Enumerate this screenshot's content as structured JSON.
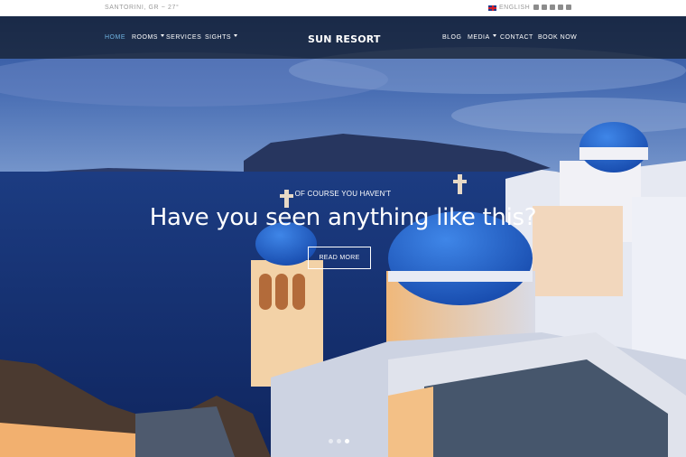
{
  "topbar": {
    "location": "SANTORINI, GR ~ 27°",
    "language": "ENGLISH",
    "socials": [
      "facebook-icon",
      "twitter-icon",
      "youtube-icon",
      "instagram-icon",
      "linkedin-icon"
    ]
  },
  "nav": {
    "brand": "SUN RESORT",
    "left": [
      {
        "label": "HOME",
        "active": true,
        "dropdown": false
      },
      {
        "label": "ROOMS",
        "active": false,
        "dropdown": true
      },
      {
        "label": "SERVICES",
        "active": false,
        "dropdown": false
      },
      {
        "label": "SIGHTS",
        "active": false,
        "dropdown": true
      }
    ],
    "right": [
      {
        "label": "BLOG",
        "dropdown": false
      },
      {
        "label": "MEDIA",
        "dropdown": true
      },
      {
        "label": "CONTACT",
        "dropdown": false
      },
      {
        "label": "BOOK NOW",
        "dropdown": false
      }
    ]
  },
  "hero": {
    "eyebrow": "OF COURSE YOU HAVEN'T",
    "headline": "Have you seen anything like this?",
    "cta": "READ MORE",
    "slides": 3,
    "active_slide": 3
  },
  "colors": {
    "accent": "#6fb3e0",
    "dome": "#1e5fc8",
    "sky": "#1a3a7a"
  }
}
